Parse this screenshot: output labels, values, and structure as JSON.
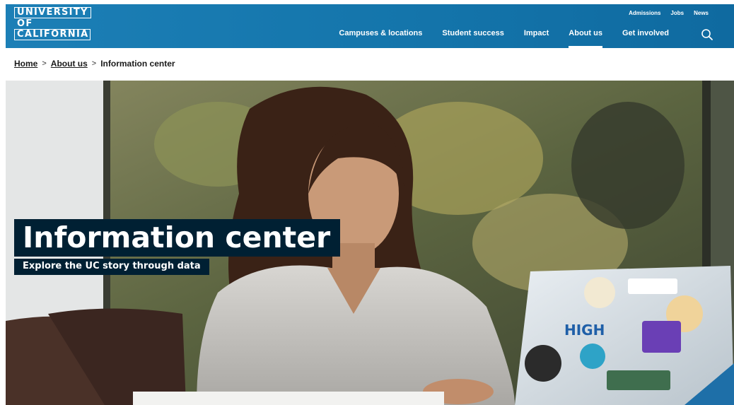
{
  "logo": {
    "line1": "UNIVERSITY",
    "line2": "OF",
    "line3": "CALIFORNIA"
  },
  "utility_nav": [
    "Admissions",
    "Jobs",
    "News"
  ],
  "main_nav": [
    {
      "label": "Campuses & locations",
      "active": false
    },
    {
      "label": "Student success",
      "active": false
    },
    {
      "label": "Impact",
      "active": false
    },
    {
      "label": "About us",
      "active": true
    },
    {
      "label": "Get involved",
      "active": false
    }
  ],
  "search": {
    "icon": "search-icon"
  },
  "breadcrumb": {
    "home": "Home",
    "parent": "About us",
    "current": "Information center",
    "separator": ">"
  },
  "hero": {
    "title": "Information center",
    "subtitle": "Explore the UC story through data"
  },
  "colors": {
    "header": "#1475ab",
    "hero_label_bg": "#002033",
    "text": "#1a1a1a"
  }
}
